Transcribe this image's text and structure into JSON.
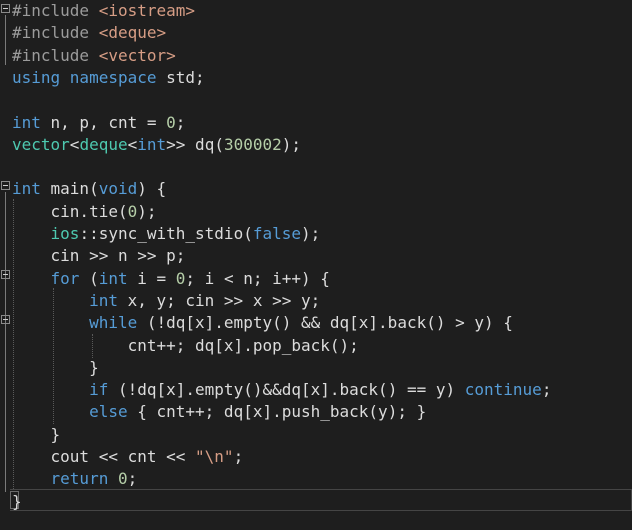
{
  "editor": {
    "language": "C++",
    "theme_colors": {
      "background": "#1e1e1e",
      "keyword": "#569cd6",
      "preprocessor": "#9b9b9b",
      "string": "#d69d85",
      "number": "#b5cea8",
      "type": "#4ec9b0",
      "text": "#dcdcdc"
    },
    "lines": [
      {
        "tokens": [
          {
            "t": "#include ",
            "c": "pp"
          },
          {
            "t": "<iostream>",
            "c": "str"
          }
        ]
      },
      {
        "tokens": [
          {
            "t": "#include ",
            "c": "pp"
          },
          {
            "t": "<deque>",
            "c": "str"
          }
        ]
      },
      {
        "tokens": [
          {
            "t": "#include ",
            "c": "pp"
          },
          {
            "t": "<vector>",
            "c": "str"
          }
        ]
      },
      {
        "tokens": [
          {
            "t": "using ",
            "c": "kw"
          },
          {
            "t": "namespace ",
            "c": "kw"
          },
          {
            "t": "std;",
            "c": "plain"
          }
        ]
      },
      {
        "tokens": []
      },
      {
        "tokens": [
          {
            "t": "int ",
            "c": "kw"
          },
          {
            "t": "n, p, cnt = ",
            "c": "plain"
          },
          {
            "t": "0",
            "c": "num"
          },
          {
            "t": ";",
            "c": "plain"
          }
        ]
      },
      {
        "tokens": [
          {
            "t": "vector",
            "c": "type"
          },
          {
            "t": "<",
            "c": "plain"
          },
          {
            "t": "deque",
            "c": "type"
          },
          {
            "t": "<",
            "c": "plain"
          },
          {
            "t": "int",
            "c": "kw"
          },
          {
            "t": ">> dq(",
            "c": "plain"
          },
          {
            "t": "300002",
            "c": "num"
          },
          {
            "t": ");",
            "c": "plain"
          }
        ]
      },
      {
        "tokens": []
      },
      {
        "tokens": [
          {
            "t": "int ",
            "c": "kw"
          },
          {
            "t": "main(",
            "c": "plain"
          },
          {
            "t": "void",
            "c": "kw"
          },
          {
            "t": ") {",
            "c": "plain"
          }
        ]
      },
      {
        "tokens": [
          {
            "t": "    cin.tie(",
            "c": "plain"
          },
          {
            "t": "0",
            "c": "num"
          },
          {
            "t": ");",
            "c": "plain"
          }
        ]
      },
      {
        "tokens": [
          {
            "t": "    ",
            "c": "plain"
          },
          {
            "t": "ios",
            "c": "type"
          },
          {
            "t": "::sync_with_stdio(",
            "c": "plain"
          },
          {
            "t": "false",
            "c": "kw"
          },
          {
            "t": ");",
            "c": "plain"
          }
        ]
      },
      {
        "tokens": [
          {
            "t": "    cin >> n >> p;",
            "c": "plain"
          }
        ]
      },
      {
        "tokens": [
          {
            "t": "    ",
            "c": "plain"
          },
          {
            "t": "for ",
            "c": "kw"
          },
          {
            "t": "(",
            "c": "plain"
          },
          {
            "t": "int ",
            "c": "kw"
          },
          {
            "t": "i = ",
            "c": "plain"
          },
          {
            "t": "0",
            "c": "num"
          },
          {
            "t": "; i < n; i++) {",
            "c": "plain"
          }
        ]
      },
      {
        "tokens": [
          {
            "t": "        ",
            "c": "plain"
          },
          {
            "t": "int ",
            "c": "kw"
          },
          {
            "t": "x, y; cin >> x >> y;",
            "c": "plain"
          }
        ]
      },
      {
        "tokens": [
          {
            "t": "        ",
            "c": "plain"
          },
          {
            "t": "while ",
            "c": "kw"
          },
          {
            "t": "(!dq[x].empty() && dq[x].back() > y) {",
            "c": "plain"
          }
        ]
      },
      {
        "tokens": [
          {
            "t": "            cnt++; dq[x].pop_back();",
            "c": "plain"
          }
        ]
      },
      {
        "tokens": [
          {
            "t": "        }",
            "c": "plain"
          }
        ]
      },
      {
        "tokens": [
          {
            "t": "        ",
            "c": "plain"
          },
          {
            "t": "if ",
            "c": "kw"
          },
          {
            "t": "(!dq[x].empty()&&dq[x].back() == y) ",
            "c": "plain"
          },
          {
            "t": "continue",
            "c": "kw"
          },
          {
            "t": ";",
            "c": "plain"
          }
        ]
      },
      {
        "tokens": [
          {
            "t": "        ",
            "c": "plain"
          },
          {
            "t": "else ",
            "c": "kw"
          },
          {
            "t": "{ cnt++; dq[x].push_back(y); }",
            "c": "plain"
          }
        ]
      },
      {
        "tokens": [
          {
            "t": "    }",
            "c": "plain"
          }
        ]
      },
      {
        "tokens": [
          {
            "t": "    cout << cnt << ",
            "c": "plain"
          },
          {
            "t": "\"\\n\"",
            "c": "str"
          },
          {
            "t": ";",
            "c": "plain"
          }
        ]
      },
      {
        "tokens": [
          {
            "t": "    ",
            "c": "plain"
          },
          {
            "t": "return ",
            "c": "kw"
          },
          {
            "t": "0",
            "c": "num"
          },
          {
            "t": ";",
            "c": "plain"
          }
        ]
      },
      {
        "tokens": [
          {
            "t": "}",
            "c": "plain"
          }
        ]
      }
    ]
  }
}
